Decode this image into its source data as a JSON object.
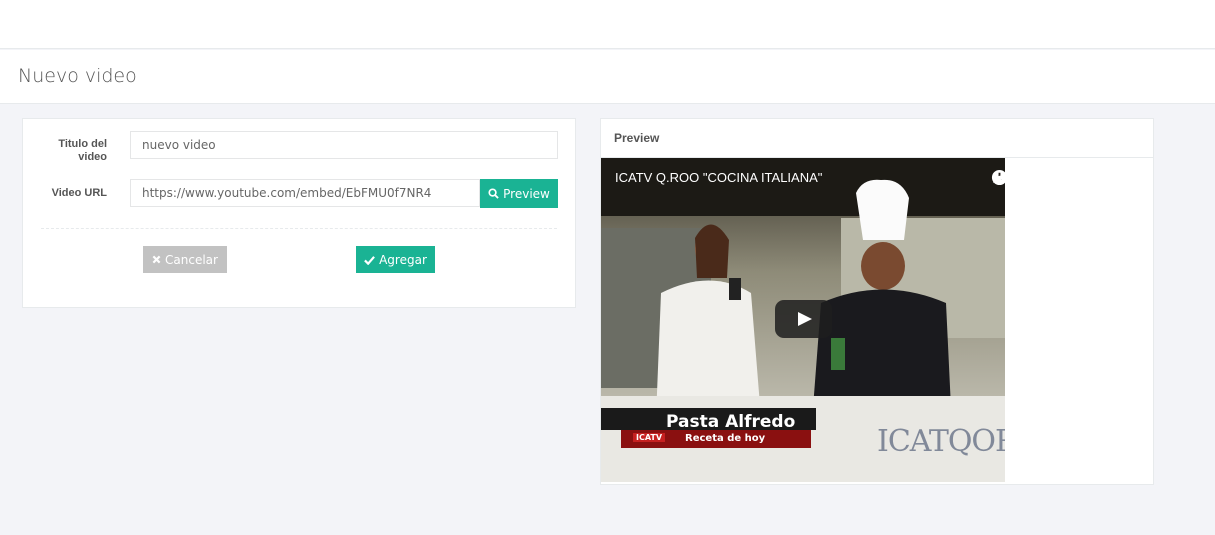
{
  "page": {
    "title": "Nuevo video"
  },
  "form": {
    "title_label": "Titulo del video",
    "title_value": "nuevo video",
    "url_label": "Video URL",
    "url_value": "https://www.youtube.com/embed/EbFMU0f7NR4",
    "preview_button": "Preview",
    "cancel_button": "Cancelar",
    "add_button": "Agregar"
  },
  "preview": {
    "panel_title": "Preview",
    "video_title": "ICATV Q.ROO \"COCINA ITALIANA\"",
    "caption_main": "Pasta Alfredo",
    "caption_sub": "Receta de hoy",
    "caption_brand": "ICATV",
    "watermark": "ICATQOR"
  },
  "icons": {
    "search": "search-icon",
    "times": "times-icon",
    "check": "check-icon",
    "clock": "clock-icon",
    "share": "share-icon",
    "play": "play-icon"
  },
  "colors": {
    "accent": "#1ab394",
    "cancel": "#c2c2c2",
    "background": "#f3f4f8"
  }
}
